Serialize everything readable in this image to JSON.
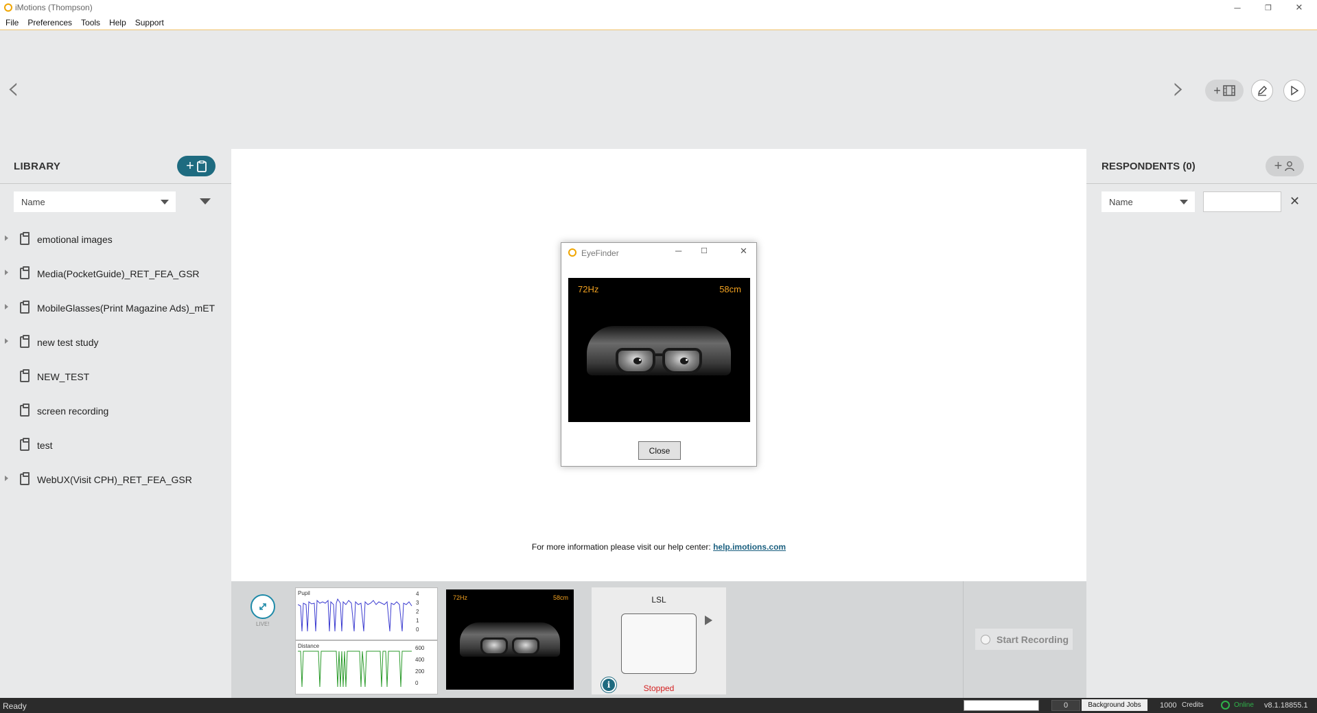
{
  "window": {
    "title": "iMotions (Thompson)",
    "controls": {
      "minimize": "─",
      "restore": "❐",
      "close": "✕"
    }
  },
  "menu": [
    "File",
    "Preferences",
    "Tools",
    "Help",
    "Support"
  ],
  "topnav": {
    "prev_glyph": "‹",
    "next_glyph": "›",
    "add_stimulus_icon": "plus-film-icon",
    "edit_icon": "pencil-icon",
    "play_icon": "play-icon"
  },
  "library": {
    "title": "LIBRARY",
    "sort_value": "Name",
    "items": [
      {
        "label": "emotional images",
        "expandable": true
      },
      {
        "label": "Media(PocketGuide)_RET_FEA_GSR",
        "expandable": true
      },
      {
        "label": "MobileGlasses(Print Magazine Ads)_mET",
        "expandable": true
      },
      {
        "label": "new test study",
        "expandable": true
      },
      {
        "label": "NEW_TEST",
        "expandable": false
      },
      {
        "label": "screen recording",
        "expandable": false
      },
      {
        "label": "test",
        "expandable": false
      },
      {
        "label": "WebUX(Visit CPH)_RET_FEA_GSR",
        "expandable": true
      }
    ]
  },
  "respondents": {
    "title": "RESPONDENTS (0)",
    "sort_value": "Name",
    "search_value": "",
    "clear_glyph": "✕"
  },
  "center": {
    "help_text": "For more information please visit our help center:",
    "help_link": "help.imotions.com"
  },
  "eyefinder": {
    "title": "EyeFinder",
    "frequency": "72Hz",
    "distance": "58cm",
    "close_label": "Close"
  },
  "bottom": {
    "live_label": "LIVE!",
    "graph": {
      "pupil_title": "Pupil",
      "pupil_ticks": [
        "4",
        "3",
        "2",
        "1",
        "0"
      ],
      "distance_title": "Distance",
      "distance_ticks": [
        "600",
        "400",
        "200",
        "0"
      ]
    },
    "mini_cam": {
      "frequency": "72Hz",
      "distance": "58cm"
    },
    "lsl": {
      "title": "LSL",
      "status": "Stopped"
    },
    "record_label": "Start Recording"
  },
  "statusbar": {
    "ready": "Ready",
    "jobs_count": "0",
    "jobs_label": "Background Jobs",
    "credits_count": "1000",
    "credits_label": "Credits",
    "online_label": "Online",
    "version": "v8.1.18855.1"
  },
  "colors": {
    "accent": "#1e6b80",
    "warning_orange": "#f0a020",
    "stopped_red": "#d42020",
    "online_green": "#2fb34a"
  }
}
